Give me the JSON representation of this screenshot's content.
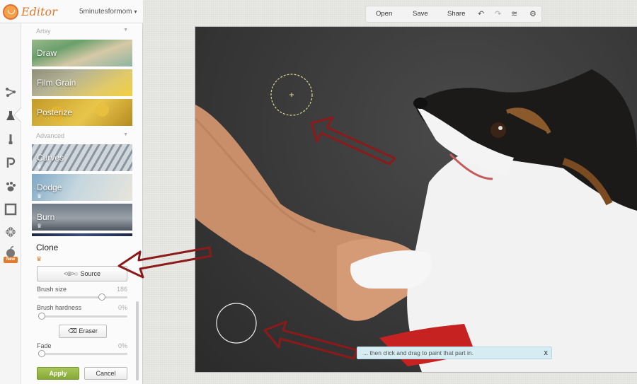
{
  "header": {
    "brand": "Editor",
    "account": "5minutesformom",
    "account_caret": "▾"
  },
  "toolbar": {
    "open": "Open",
    "save": "Save",
    "share": "Share"
  },
  "panel": {
    "section_artsy": "Artsy",
    "section_advanced": "Advanced",
    "effects": [
      "Draw",
      "Film Grain",
      "Posterize",
      "Curves",
      "Dodge",
      "Burn"
    ],
    "clone": {
      "title": "Clone",
      "source_label": "Source",
      "brush_size_label": "Brush size",
      "brush_size_value": "186",
      "brush_size_fraction": 0.73,
      "brush_hardness_label": "Brush hardness",
      "brush_hardness_value": "0%",
      "brush_hardness_fraction": 0.0,
      "eraser_label": "Eraser",
      "fade_label": "Fade",
      "fade_value": "0%",
      "fade_fraction": 0.0,
      "apply_label": "Apply",
      "cancel_label": "Cancel"
    }
  },
  "rail": {
    "new_badge": "New"
  },
  "canvas": {
    "tip_text": "... then click and drag to paint that part in.",
    "tip_close": "x"
  },
  "colors": {
    "accent": "#e07a2d",
    "apply": "#94b545",
    "annotation": "#8b1a1a",
    "tip_bg": "#d5ecf2"
  }
}
